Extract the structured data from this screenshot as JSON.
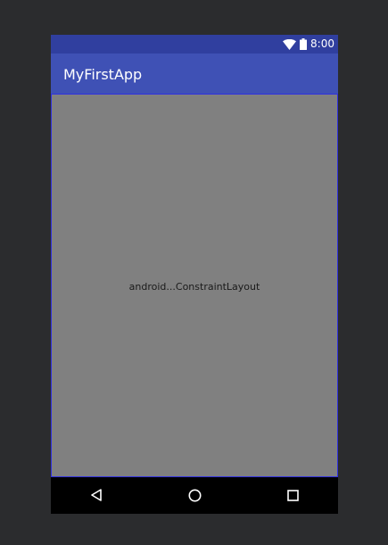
{
  "status_bar": {
    "time": "8:00",
    "icons": [
      "wifi-icon",
      "battery-icon"
    ]
  },
  "app_bar": {
    "title": "MyFirstApp"
  },
  "content": {
    "label": "android...ConstraintLayout"
  },
  "nav_bar": {
    "buttons": [
      "back-icon",
      "home-icon",
      "recents-icon"
    ]
  },
  "colors": {
    "background": "#2b2c2e",
    "status_bar": "#303f9f",
    "app_bar": "#3f51b5",
    "content": "#808080",
    "content_border": "#2f2fe0",
    "nav_bar": "#000000"
  }
}
